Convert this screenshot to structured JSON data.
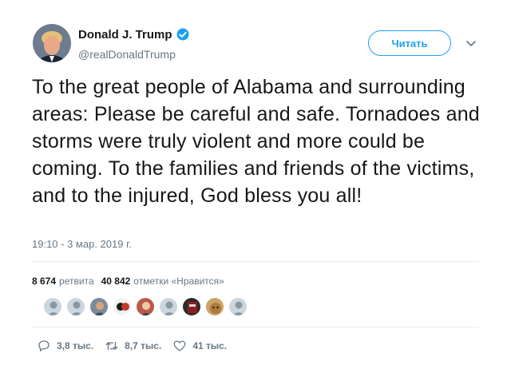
{
  "header": {
    "display_name": "Donald J. Trump",
    "handle": "@realDonaldTrump",
    "follow_label": "Читать"
  },
  "tweet": {
    "text": "To the great people of Alabama and surrounding areas: Please be careful and safe. Tornadoes and storms were truly violent and more could be coming. To the families and friends of the victims, and to the injured, God bless you all!",
    "timestamp": "19:10 - 3 мар. 2019 г."
  },
  "stats": {
    "retweets_count": "8 674",
    "retweets_label": "ретвита",
    "likes_count": "40 842",
    "likes_label": "отметки «Нравится»"
  },
  "likers": [
    {
      "icon": "default-avatar-icon"
    },
    {
      "icon": "default-avatar-icon"
    },
    {
      "icon": "user-avatar-icon"
    },
    {
      "icon": "user-avatar-icon"
    },
    {
      "icon": "user-avatar-icon"
    },
    {
      "icon": "default-avatar-icon"
    },
    {
      "icon": "user-avatar-icon"
    },
    {
      "icon": "dog-avatar-icon"
    },
    {
      "icon": "default-avatar-icon"
    }
  ],
  "actions": {
    "reply_count": "3,8 тыс.",
    "retweet_count": "8,7 тыс.",
    "like_count": "41 тыс."
  },
  "colors": {
    "accent": "#1da1f2",
    "text": "#14171a",
    "secondary": "#657786",
    "divider": "#e6ecf0"
  }
}
